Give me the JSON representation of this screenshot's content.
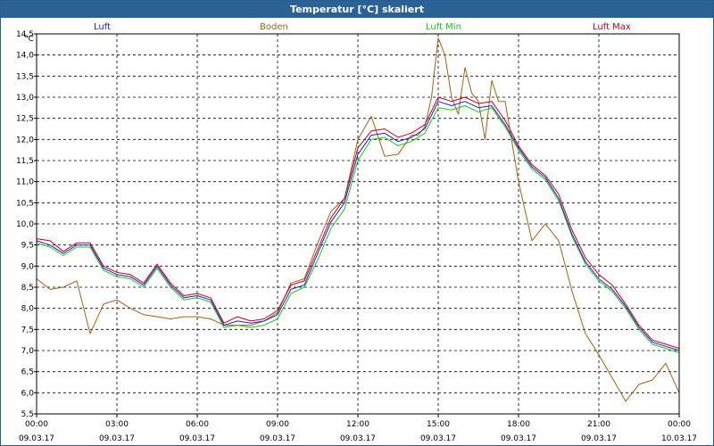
{
  "window": {
    "title": "Temperatur [°C] skaliert"
  },
  "legend": [
    {
      "label": "Luft",
      "color": "#2020c0"
    },
    {
      "label": "Boden",
      "color": "#a0601a"
    },
    {
      "label": "Luft Min",
      "color": "#20c020"
    },
    {
      "label": "Luft Max",
      "color": "#c00020"
    }
  ],
  "chart_data": {
    "type": "line",
    "y_unit": "°C",
    "ylim": [
      5.5,
      14.5
    ],
    "xlim": [
      "09.03.17 00:00",
      "10.03.17 00:00"
    ],
    "grid": true,
    "y_ticks": [
      "5,5",
      "6,0",
      "6,5",
      "7,0",
      "7,5",
      "8,0",
      "8,5",
      "9,0",
      "9,5",
      "10,0",
      "10,5",
      "11,0",
      "11,5",
      "12,0",
      "12,5",
      "13,0",
      "13,5",
      "14,0",
      "14,5"
    ],
    "x_ticks": [
      {
        "time": "00:00",
        "date": "09.03.17"
      },
      {
        "time": "03:00",
        "date": "09.03.17"
      },
      {
        "time": "06:00",
        "date": "09.03.17"
      },
      {
        "time": "09:00",
        "date": "09.03.17"
      },
      {
        "time": "12:00",
        "date": "09.03.17"
      },
      {
        "time": "15:00",
        "date": "09.03.17"
      },
      {
        "time": "18:00",
        "date": "09.03.17"
      },
      {
        "time": "21:00",
        "date": "09.03.17"
      },
      {
        "time": "00:00",
        "date": "10.03.17"
      }
    ],
    "series": [
      {
        "name": "Luft",
        "color": "#2020c0",
        "x": [
          "00:00",
          "00:30",
          "01:00",
          "01:30",
          "02:00",
          "02:30",
          "03:00",
          "03:30",
          "04:00",
          "04:30",
          "05:00",
          "05:30",
          "06:00",
          "06:30",
          "07:00",
          "07:30",
          "08:00",
          "08:30",
          "09:00",
          "09:30",
          "10:00",
          "10:30",
          "11:00",
          "11:30",
          "12:00",
          "12:30",
          "13:00",
          "13:30",
          "14:00",
          "14:30",
          "15:00",
          "15:30",
          "16:00",
          "16:30",
          "17:00",
          "17:30",
          "18:00",
          "18:30",
          "19:00",
          "19:30",
          "20:00",
          "20:30",
          "21:00",
          "21:30",
          "22:00",
          "22:30",
          "23:00",
          "23:30",
          "24:00"
        ],
        "values": [
          9.6,
          9.5,
          9.3,
          9.5,
          9.5,
          8.95,
          8.8,
          8.75,
          8.55,
          9.0,
          8.55,
          8.25,
          8.3,
          8.2,
          7.6,
          7.7,
          7.65,
          7.7,
          7.85,
          8.45,
          8.55,
          9.3,
          10.05,
          10.5,
          11.65,
          12.1,
          12.15,
          11.95,
          12.05,
          12.25,
          12.9,
          12.8,
          12.9,
          12.75,
          12.8,
          12.35,
          11.8,
          11.35,
          11.1,
          10.6,
          9.75,
          9.1,
          8.7,
          8.45,
          8.05,
          7.55,
          7.2,
          7.1,
          7.0
        ]
      },
      {
        "name": "Boden",
        "color": "#a0601a",
        "x": [
          "00:00",
          "00:30",
          "01:00",
          "01:30",
          "02:00",
          "02:30",
          "03:00",
          "03:30",
          "04:00",
          "04:30",
          "05:00",
          "05:30",
          "06:00",
          "06:30",
          "07:00",
          "07:30",
          "08:00",
          "08:30",
          "09:00",
          "09:30",
          "10:00",
          "10:30",
          "11:00",
          "11:30",
          "12:00",
          "12:30",
          "13:00",
          "13:30",
          "14:00",
          "14:15",
          "14:30",
          "14:45",
          "15:00",
          "15:15",
          "15:30",
          "15:45",
          "16:00",
          "16:15",
          "16:30",
          "16:45",
          "17:00",
          "17:15",
          "17:30",
          "18:00",
          "18:30",
          "19:00",
          "19:30",
          "20:00",
          "20:30",
          "21:00",
          "21:30",
          "22:00",
          "22:30",
          "23:00",
          "23:30",
          "24:00"
        ],
        "values": [
          8.7,
          8.45,
          8.5,
          8.65,
          7.4,
          8.1,
          8.2,
          8.0,
          7.85,
          7.8,
          7.75,
          7.8,
          7.8,
          7.75,
          7.6,
          7.6,
          7.6,
          7.7,
          7.9,
          8.6,
          8.7,
          9.55,
          10.3,
          10.6,
          12.0,
          12.55,
          11.6,
          11.65,
          12.1,
          12.1,
          12.3,
          13.0,
          14.4,
          14.0,
          13.0,
          12.6,
          13.7,
          13.1,
          12.9,
          12.0,
          13.4,
          12.9,
          12.9,
          11.0,
          9.6,
          10.0,
          9.6,
          8.4,
          7.4,
          6.9,
          6.35,
          5.8,
          6.2,
          6.3,
          6.7,
          6.0
        ]
      },
      {
        "name": "Luft Min",
        "color": "#20c020",
        "x": [
          "00:00",
          "00:30",
          "01:00",
          "01:30",
          "02:00",
          "02:30",
          "03:00",
          "03:30",
          "04:00",
          "04:30",
          "05:00",
          "05:30",
          "06:00",
          "06:30",
          "07:00",
          "07:30",
          "08:00",
          "08:30",
          "09:00",
          "09:30",
          "10:00",
          "10:30",
          "11:00",
          "11:30",
          "12:00",
          "12:30",
          "13:00",
          "13:30",
          "14:00",
          "14:30",
          "15:00",
          "15:30",
          "16:00",
          "16:30",
          "17:00",
          "17:30",
          "18:00",
          "18:30",
          "19:00",
          "19:30",
          "20:00",
          "20:30",
          "21:00",
          "21:30",
          "22:00",
          "22:30",
          "23:00",
          "23:30",
          "24:00"
        ],
        "values": [
          9.55,
          9.45,
          9.25,
          9.45,
          9.45,
          8.9,
          8.75,
          8.7,
          8.5,
          8.95,
          8.5,
          8.2,
          8.25,
          8.15,
          7.55,
          7.6,
          7.55,
          7.6,
          7.75,
          8.35,
          8.5,
          9.15,
          9.9,
          10.35,
          11.5,
          12.0,
          12.05,
          11.85,
          11.95,
          12.15,
          12.75,
          12.7,
          12.8,
          12.65,
          12.75,
          12.3,
          11.75,
          11.3,
          11.05,
          10.55,
          9.7,
          9.05,
          8.65,
          8.4,
          8.0,
          7.5,
          7.15,
          7.05,
          6.95
        ]
      },
      {
        "name": "Luft Max",
        "color": "#c00020",
        "x": [
          "00:00",
          "00:30",
          "01:00",
          "01:30",
          "02:00",
          "02:30",
          "03:00",
          "03:30",
          "04:00",
          "04:30",
          "05:00",
          "05:30",
          "06:00",
          "06:30",
          "07:00",
          "07:30",
          "08:00",
          "08:30",
          "09:00",
          "09:30",
          "10:00",
          "10:30",
          "11:00",
          "11:30",
          "12:00",
          "12:30",
          "13:00",
          "13:30",
          "14:00",
          "14:30",
          "15:00",
          "15:30",
          "16:00",
          "16:30",
          "17:00",
          "17:30",
          "18:00",
          "18:30",
          "19:00",
          "19:30",
          "20:00",
          "20:30",
          "21:00",
          "21:30",
          "22:00",
          "22:30",
          "23:00",
          "23:30",
          "24:00"
        ],
        "values": [
          9.65,
          9.6,
          9.35,
          9.55,
          9.55,
          9.0,
          8.85,
          8.8,
          8.6,
          9.05,
          8.6,
          8.3,
          8.35,
          8.25,
          7.65,
          7.8,
          7.7,
          7.75,
          7.95,
          8.55,
          8.65,
          9.4,
          10.15,
          10.6,
          11.8,
          12.2,
          12.25,
          12.05,
          12.15,
          12.35,
          13.0,
          12.9,
          13.0,
          12.85,
          12.9,
          12.45,
          11.85,
          11.4,
          11.15,
          10.7,
          9.85,
          9.2,
          8.8,
          8.55,
          8.1,
          7.6,
          7.25,
          7.15,
          7.05
        ]
      }
    ]
  }
}
